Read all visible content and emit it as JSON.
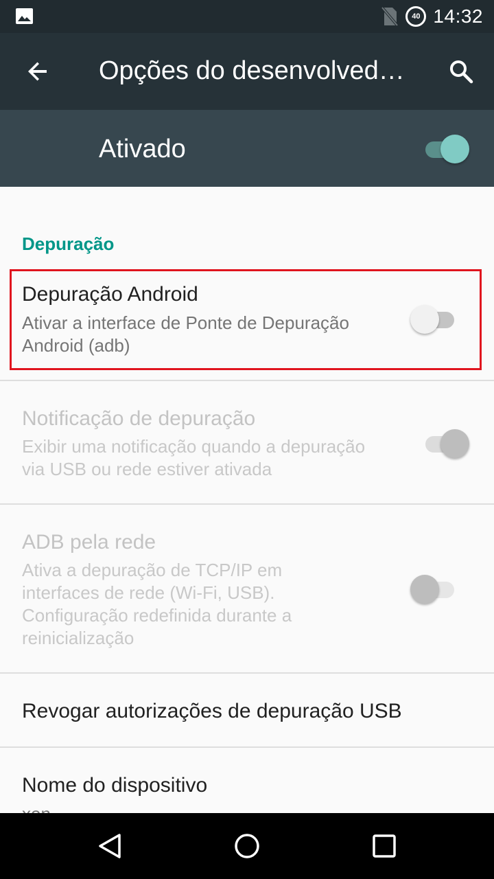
{
  "status_bar": {
    "time": "14:32",
    "battery_level": "40",
    "icons": [
      "image-notification-icon",
      "no-sim-icon",
      "battery-saver-icon"
    ]
  },
  "app_bar": {
    "title": "Opções do desenvolved…",
    "icons": [
      "back-arrow-icon",
      "search-icon"
    ]
  },
  "master": {
    "label": "Ativado",
    "state": "on"
  },
  "section": {
    "header": "Depuração"
  },
  "preferences": [
    {
      "title": "Depuração Android",
      "summary": "Ativar a interface de Ponte de Depuração Android (adb)",
      "state": "off",
      "enabled": true
    },
    {
      "title": "Notificação de depuração",
      "summary": "Exibir uma notificação quando a depuração via USB ou rede estiver ativada",
      "state": "on",
      "enabled": false
    },
    {
      "title": "ADB pela rede",
      "summary": "Ativa a depuração de TCP/IP em interfaces de rede (Wi-Fi, USB). Configuração redefinida durante a reinicialização",
      "state": "off",
      "enabled": false
    },
    {
      "title": "Revogar autorizações de depuração USB"
    },
    {
      "title": "Nome do dispositivo",
      "summary": "xen"
    }
  ],
  "colors": {
    "app_bar": "#263238",
    "master_bar": "#37474f",
    "accent": "#009688",
    "highlight_border": "#e0141e"
  },
  "nav_bar": {
    "icons": [
      "back-triangle-icon",
      "home-circle-icon",
      "recents-square-icon"
    ]
  }
}
